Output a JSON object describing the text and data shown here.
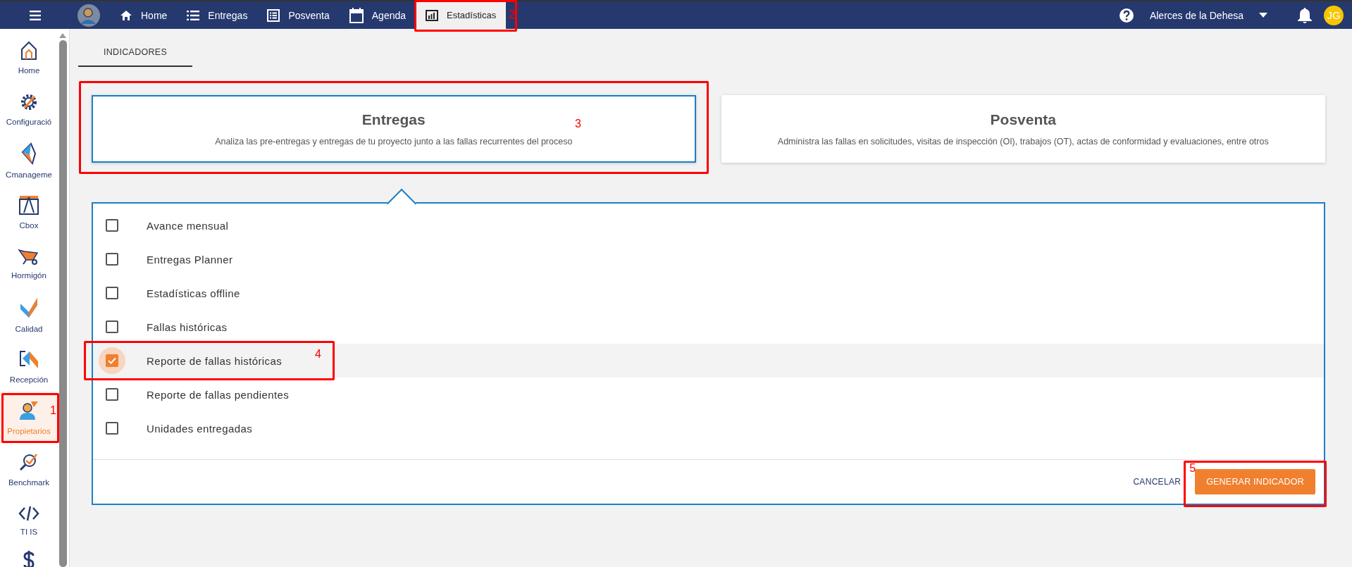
{
  "topbar": {
    "nav": [
      {
        "label": "Home",
        "selected": false
      },
      {
        "label": "Entregas",
        "selected": false
      },
      {
        "label": "Posventa",
        "selected": false
      },
      {
        "label": "Agenda",
        "selected": false
      },
      {
        "label": "Estadísticas",
        "selected": true,
        "annotation": "2"
      }
    ],
    "project": "Alerces de la Dehesa",
    "user_initials": "JG"
  },
  "sidebar": {
    "items": [
      {
        "label": "Home",
        "selected": false
      },
      {
        "label": "Configuració",
        "selected": false
      },
      {
        "label": "Cmanageme",
        "selected": false
      },
      {
        "label": "Cbox",
        "selected": false
      },
      {
        "label": "Hormigón",
        "selected": false
      },
      {
        "label": "Calidad",
        "selected": false
      },
      {
        "label": "Recepción",
        "selected": false
      },
      {
        "label": "Propietarios",
        "selected": true,
        "annotation": "1"
      },
      {
        "label": "Benchmark",
        "selected": false
      },
      {
        "label": "TI IS",
        "selected": false
      },
      {
        "selected": false
      }
    ]
  },
  "tabs": [
    {
      "label": "INDICADORES",
      "selected": true
    }
  ],
  "cards": [
    {
      "title": "Entregas",
      "description": "Analiza las pre-entregas y entregas de tu proyecto junto a las fallas recurrentes del proceso",
      "selected": true,
      "annotation": "3"
    },
    {
      "title": "Posventa",
      "description": "Administra las fallas en solicitudes, visitas de inspección (OI), trabajos (OT), actas de conformidad y evaluaciones, entre otros",
      "selected": false
    }
  ],
  "indicators": [
    {
      "label": "Avance mensual",
      "checked": false,
      "selected": false
    },
    {
      "label": "Entregas Planner",
      "checked": false,
      "selected": false
    },
    {
      "label": "Estadísticas offline",
      "checked": false,
      "selected": false
    },
    {
      "label": "Fallas históricas",
      "checked": false,
      "selected": false
    },
    {
      "label": "Reporte de fallas históricas",
      "checked": true,
      "selected": true,
      "annotation": "4"
    },
    {
      "label": "Reporte de fallas pendientes",
      "checked": false,
      "selected": false
    },
    {
      "label": "Unidades entregadas",
      "checked": false,
      "selected": false
    }
  ],
  "actions": {
    "cancel": "CANCELAR",
    "submit": {
      "label": "GENERAR INDICADOR",
      "annotation": "5"
    }
  }
}
